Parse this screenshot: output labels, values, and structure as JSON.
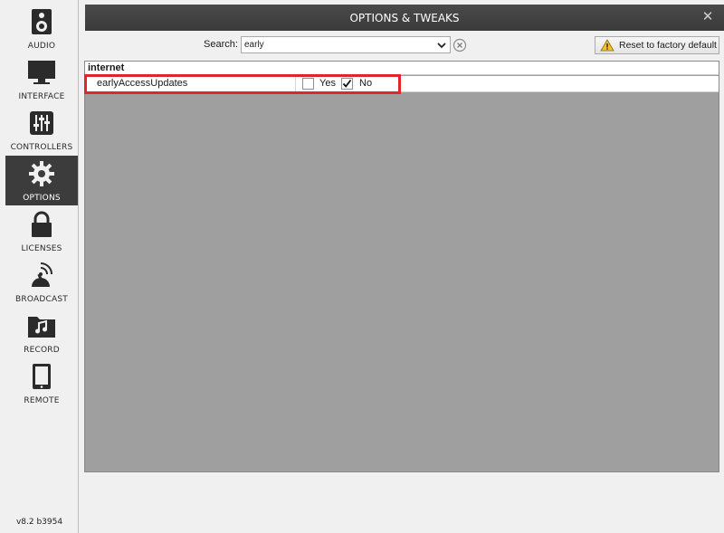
{
  "sidebar": {
    "items": [
      {
        "label": "AUDIO",
        "icon": "speaker-icon"
      },
      {
        "label": "INTERFACE",
        "icon": "monitor-icon"
      },
      {
        "label": "CONTROLLERS",
        "icon": "sliders-icon"
      },
      {
        "label": "OPTIONS",
        "icon": "gear-icon",
        "active": true
      },
      {
        "label": "LICENSES",
        "icon": "lock-icon"
      },
      {
        "label": "BROADCAST",
        "icon": "broadcast-icon"
      },
      {
        "label": "RECORD",
        "icon": "music-folder-icon"
      },
      {
        "label": "REMOTE",
        "icon": "tablet-icon"
      }
    ],
    "version": "v8.2 b3954"
  },
  "window": {
    "title": "OPTIONS & TWEAKS",
    "close_glyph": "✕"
  },
  "search": {
    "label": "Search:",
    "value": "early"
  },
  "reset_button": {
    "label": "Reset to factory default"
  },
  "options": {
    "group": "internet",
    "rows": [
      {
        "name": "earlyAccessUpdates",
        "yes_label": "Yes",
        "no_label": "No",
        "yes_checked": false,
        "no_checked": true
      }
    ]
  },
  "colors": {
    "highlight": "#e3242b",
    "titlebar": "#3f3f3f",
    "list_background": "#9f9f9f"
  }
}
